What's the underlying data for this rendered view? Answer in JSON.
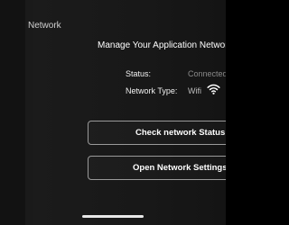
{
  "header": {
    "section_title": "Network"
  },
  "panel": {
    "title": "Manage Your Application Network S",
    "status_label": "Status:",
    "status_value": "Connected",
    "network_type_label": "Network Type:",
    "network_type_value": "Wifi",
    "network_type_icon": "wifi-icon"
  },
  "actions": {
    "check_status_label": "Check network Status",
    "open_settings_label": "Open Network Settings"
  },
  "colors": {
    "background": "#181818",
    "text": "#ffffff",
    "muted_text": "#8a8a8a",
    "button_border": "#9a9a9a"
  }
}
